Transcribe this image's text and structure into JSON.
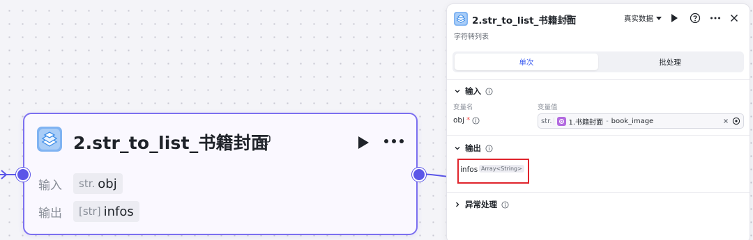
{
  "node": {
    "title": "2.str_to_list_书籍封面",
    "inputs_label": "输入",
    "outputs_label": "输出",
    "input": {
      "type": "str.",
      "name": "obj"
    },
    "output": {
      "type": "[str]",
      "name": "infos"
    }
  },
  "panel": {
    "title": "2.str_to_list_书籍封面",
    "subtitle": "字符转列表",
    "data_select": "真实数据",
    "tabs": [
      {
        "label": "单次",
        "active": true
      },
      {
        "label": "批处理",
        "active": false
      }
    ],
    "input_section": {
      "label": "输入",
      "col_name": "变量名",
      "col_value": "变量值",
      "var_name": "obj",
      "required_mark": "*",
      "value_type": "str.",
      "ref_node": "1.书籍封面",
      "ref_sep": "-",
      "ref_field": "book_image"
    },
    "output_section": {
      "label": "输出",
      "name": "infos",
      "type": "Array<String>"
    },
    "exception_section": {
      "label": "异常处理"
    }
  },
  "colors": {
    "accent": "#5b56e8",
    "node_border": "#7b6ff0",
    "highlight_box": "#e0242c",
    "tab_active_text": "#3c5cf0"
  }
}
